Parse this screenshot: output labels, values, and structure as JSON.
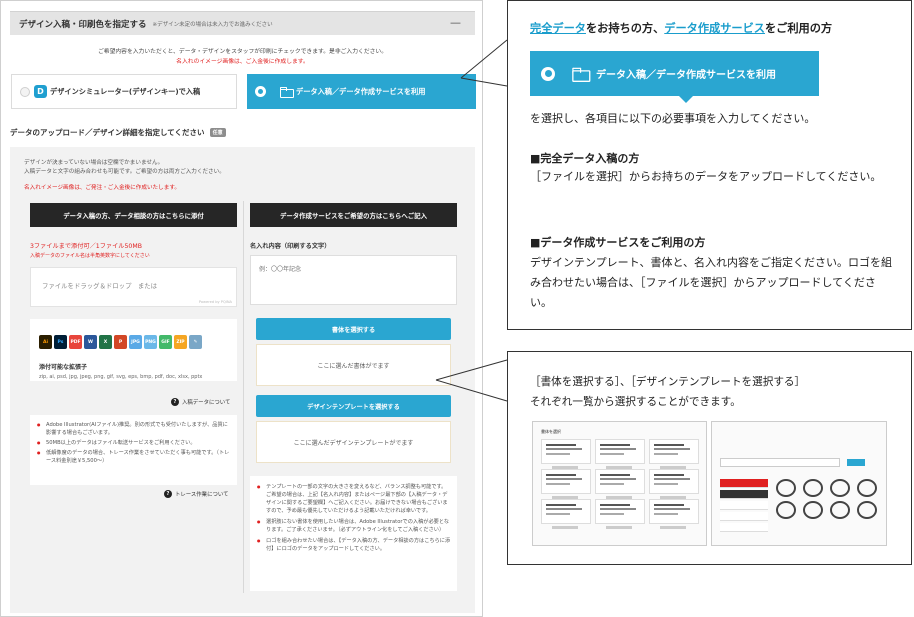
{
  "form": {
    "header_title": "デザイン入稿・印刷色を指定する",
    "header_note": "※デザイン未定の場合は未入力でお進みください",
    "header_toggle": "—",
    "intro_line1": "ご希望内容を入力いただくと、データ・デザインをスタッフが印刷にチェックできます。是非ご入力ください。",
    "intro_line2": "名入れのイメージ画像は、ご入金後に作成します。",
    "option_simulator": "デザインシミュレーター(デザインキー)で入稿",
    "option_simulator_logo": "D",
    "option_data": "データ入稿／データ作成サービスを利用",
    "upload_title": "データのアップロード／デザイン詳細を指定してください",
    "upload_badge": "任意",
    "note_line1": "デザインが決まっていない場合は空欄でかまいません。",
    "note_line2": "入稿データと文字の組み合わせも可能です。ご希望の方は両方ご入力ください。",
    "note_red": "名入れイメージ画像は、ご発注・ご入金後に作成いたします。",
    "left_col": {
      "bar": "データ入稿の方、データ相談の方はこちらに添付",
      "limit_main": "3ファイルまで添付可／1ファイル50MB",
      "limit_sub": "入稿データのファイル名は半角英数字にしてください",
      "drop_text": "ファイルをドラッグ＆ドロップ　または",
      "drop_powered": "Powered by PQINA",
      "filetypes_label": "添付可能な拡張子",
      "filetypes_list": "zip, ai, psd, jpg, jpeg, png, gif, svg, eps, bmp, pdf, doc, xlsx, pptx",
      "filetype_icons": [
        {
          "label": "Ai",
          "color": "#2b1e00",
          "text": "#ff9a00"
        },
        {
          "label": "Ps",
          "color": "#001e36",
          "text": "#31a8ff"
        },
        {
          "label": "PDF",
          "color": "#e8453c",
          "text": "#ffffff"
        },
        {
          "label": "W",
          "color": "#2b579a",
          "text": "#ffffff"
        },
        {
          "label": "X",
          "color": "#217346",
          "text": "#ffffff"
        },
        {
          "label": "P",
          "color": "#d24726",
          "text": "#ffffff"
        },
        {
          "label": "JPG",
          "color": "#5aa9e6",
          "text": "#ffffff"
        },
        {
          "label": "PNG",
          "color": "#6bb8e8",
          "text": "#ffffff"
        },
        {
          "label": "GIF",
          "color": "#43b96a",
          "text": "#ffffff"
        },
        {
          "label": "ZIP",
          "color": "#f5a623",
          "text": "#ffffff"
        },
        {
          "label": "✎",
          "color": "#7aa7c7",
          "text": "#ffffff"
        }
      ],
      "help_link": "入稿データについて",
      "notes": [
        "Adobe Illustrator(AIファイル)推奨。別の形式でも受付いたしますが、品質に影響する場合もございます。",
        "50MB以上のデータはファイル転送サービスをご利用ください。",
        "低解像度のデータの場合、トレース作業をさせていただく事も可能です。（トレース料金別途￥5,500～）"
      ],
      "help_link2": "トレース作業について"
    },
    "right_col": {
      "bar": "データ作成サービスをご希望の方はこちらへご記入",
      "name_label": "名入れ内容（印刷する文字）",
      "name_placeholder": "例：〇〇年記念",
      "font_button": "書体を選択する",
      "font_placeholder": "ここに選んだ書体がでます",
      "template_button": "デザインテンプレートを選択する",
      "template_placeholder": "ここに選んだデザインテンプレートがでます",
      "notes": [
        "テンプレートの一部の文字の大きさを変えるなど、バランス調整も可能です。ご希望の場合は、上記【名入れ内容】またはページ最下部の【入稿データ・デザインに関するご要望欄】へご記入ください。お届けできない場合もございますので、予め最も優先していただけるよう記載いただければ幸いです。",
        "選択肢にない書体を使用したい場合は、Adobe Illustratorでの入稿が必要となります。ご了承くださいませ。（必ずアウトライン化をしてご入稿ください）",
        "ロゴを組み合わせたい場合は、【データ入稿の方、データ相談の方はこちらに添付】にロゴのデータをアップロードしてください。"
      ]
    }
  },
  "callout1": {
    "title_link1": "完全データ",
    "title_mid": "をお持ちの方、",
    "title_link2": "データ作成サービス",
    "title_end": "をご利用の方",
    "button_label": "データ入稿／データ作成サービスを利用",
    "line1": "を選択し、各項目に以下の必要事項を入力してください。",
    "h1": "■完全データ入稿の方",
    "p1": "［ファイルを選択］からお持ちのデータをアップロードしてください。",
    "h2": "■データ作成サービスをご利用の方",
    "p2": "デザインテンプレート、書体と、名入れ内容をご指定ください。ロゴを組み合わせたい場合は、［ファイルを選択］からアップロードしてください。"
  },
  "callout2": {
    "line1": "［書体を選択する］、［デザインテンプレートを選択する］",
    "line2": "それぞれ一覧から選択することができます。",
    "thumb1_title": "書体を選択"
  }
}
